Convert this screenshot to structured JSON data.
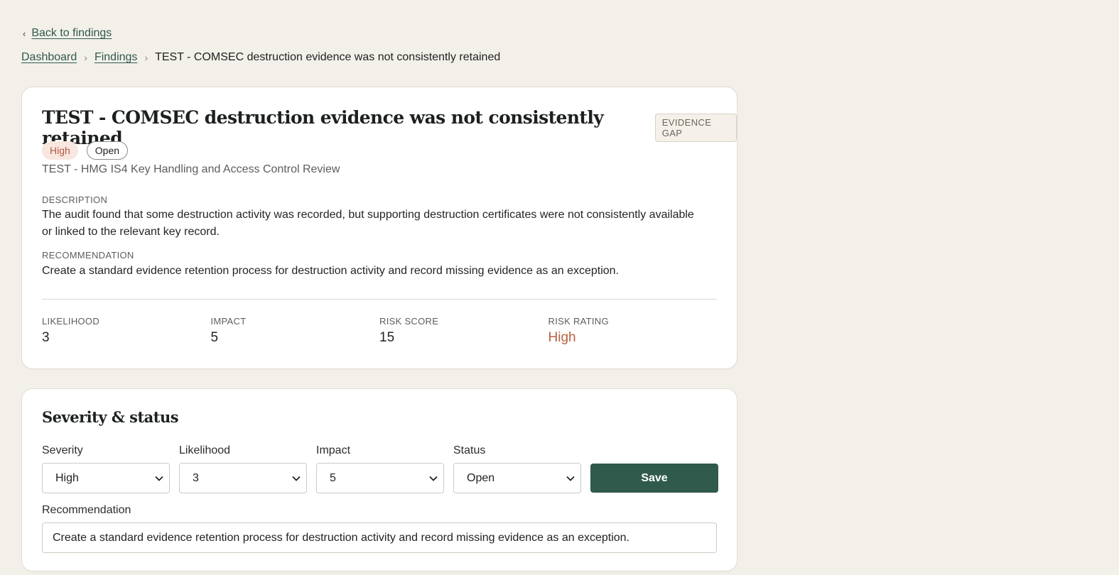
{
  "nav": {
    "back_label": "Back to findings",
    "breadcrumb": [
      {
        "label": "Dashboard"
      },
      {
        "label": "Findings"
      }
    ],
    "breadcrumb_current": "TEST - COMSEC destruction evidence was not consistently retained"
  },
  "finding": {
    "title": "TEST - COMSEC destruction evidence was not consistently retained",
    "type_badge": "EVIDENCE GAP",
    "severity_pill": "High",
    "status_pill": "Open",
    "audit_name": "TEST - HMG IS4 Key Handling and Access Control Review",
    "description_label": "DESCRIPTION",
    "description": "The audit found that some destruction activity was recorded, but supporting destruction certificates were not consistently available or linked to the relevant key record.",
    "recommendation_label": "RECOMMENDATION",
    "recommendation": "Create a standard evidence retention process for destruction activity and record missing evidence as an exception.",
    "metrics": [
      {
        "label": "LIKELIHOOD",
        "value": "3"
      },
      {
        "label": "IMPACT",
        "value": "5"
      },
      {
        "label": "RISK SCORE",
        "value": "15"
      },
      {
        "label": "RISK RATING",
        "value": "High"
      }
    ]
  },
  "severity_form": {
    "title": "Severity & status",
    "fields": [
      {
        "label": "Severity",
        "value": "High"
      },
      {
        "label": "Likelihood",
        "value": "3"
      },
      {
        "label": "Impact",
        "value": "5"
      },
      {
        "label": "Status",
        "value": "Open"
      }
    ],
    "save_label": "Save",
    "recommendation_label": "Recommendation",
    "recommendation_value": "Create a standard evidence retention process for destruction activity and record missing evidence as an exception."
  },
  "colors": {
    "background": "#f3f0ea",
    "accent": "#2f5a4c",
    "high": "#b8603f",
    "high_bg": "#f8e6e0"
  },
  "icons": [
    "chevron-left-icon",
    "chevron-right-icon",
    "chevron-down-icon"
  ]
}
